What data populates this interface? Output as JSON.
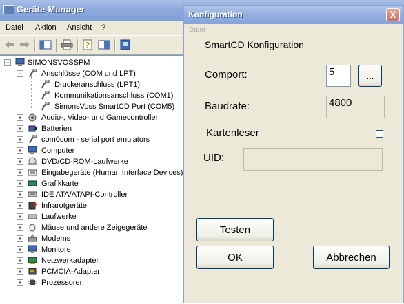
{
  "device_manager": {
    "title": "Geräte-Manager",
    "menu": [
      "Datei",
      "Aktion",
      "Ansicht",
      "?"
    ],
    "toolbar_icons": [
      "back-arrow-icon",
      "forward-arrow-icon",
      "properties-view-icon",
      "print-icon",
      "help-icon",
      "console-tree-icon",
      "scan-hardware-icon"
    ],
    "tree": {
      "root": "SIMONSVOSSPM",
      "ports_group": "Anschlüsse (COM und LPT)",
      "ports": [
        "Druckeranschluss (LPT1)",
        "Kommunikationsanschluss (COM1)",
        "SimonsVoss SmartCD Port (COM5)"
      ],
      "categories": [
        "Audio-, Video- und Gamecontroller",
        "Batterien",
        "com0com - serial port emulators",
        "Computer",
        "DVD/CD-ROM-Laufwerke",
        "Eingabegeräte (Human Interface Devices)",
        "Grafikkarte",
        "IDE ATA/ATAPI-Controller",
        "Infrarotgeräte",
        "Laufwerke",
        "Mäuse und andere Zeigegeräte",
        "Modems",
        "Monitore",
        "Netzwerkadapter",
        "PCMCIA-Adapter",
        "Prozessoren"
      ]
    }
  },
  "dialog": {
    "title": "Konfiguration",
    "close_label": "X",
    "menu_label": "Datei",
    "group_title": "SmartCD Konfiguration",
    "comport_label": "Comport:",
    "comport_value": "5",
    "browse_label": "...",
    "baudrate_label": "Baudrate:",
    "baudrate_value": "4800",
    "cardreader_label": "Kartenleser",
    "cardreader_checked": false,
    "uid_label": "UID:",
    "uid_value": "",
    "test_button": "Testen",
    "ok_button": "OK",
    "cancel_button": "Abbrechen"
  },
  "colors": {
    "titlebar": "#8eaadc",
    "window_bg": "#ece9d8",
    "close_button": "#d0725a",
    "field_border": "#7f9db9"
  }
}
